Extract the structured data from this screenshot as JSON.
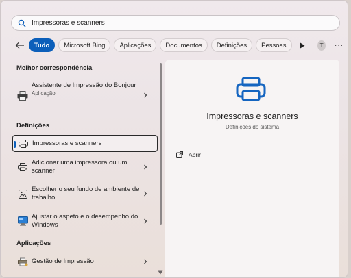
{
  "search": {
    "value": "Impressoras e scanners",
    "icon": "search-icon"
  },
  "filters": {
    "back_icon": "back-arrow-icon",
    "chips": [
      "Tudo",
      "Microsoft Bing",
      "Aplicações",
      "Documentos",
      "Definições",
      "Pessoas"
    ],
    "active": "Tudo",
    "avatar_letter": "T",
    "more": "···"
  },
  "results": {
    "best_match_title": "Melhor correspondência",
    "best_match": {
      "title": "Assistente de Impressão do Bonjour",
      "subtitle": "Aplicação"
    },
    "settings_title": "Definições",
    "settings": [
      {
        "label": "Impressoras e scanners"
      },
      {
        "label": "Adicionar uma impressora ou um scanner"
      },
      {
        "label": "Escolher o seu fundo de ambiente de trabalho"
      },
      {
        "label": "Ajustar o aspeto e o desempenho do Windows"
      }
    ],
    "apps_title": "Aplicações",
    "apps": [
      {
        "label": "Gestão de Impressão"
      }
    ]
  },
  "preview": {
    "title": "Impressoras e scanners",
    "subtitle": "Definições do sistema",
    "action_open": "Abrir"
  },
  "colors": {
    "accent": "#0c5fba"
  }
}
